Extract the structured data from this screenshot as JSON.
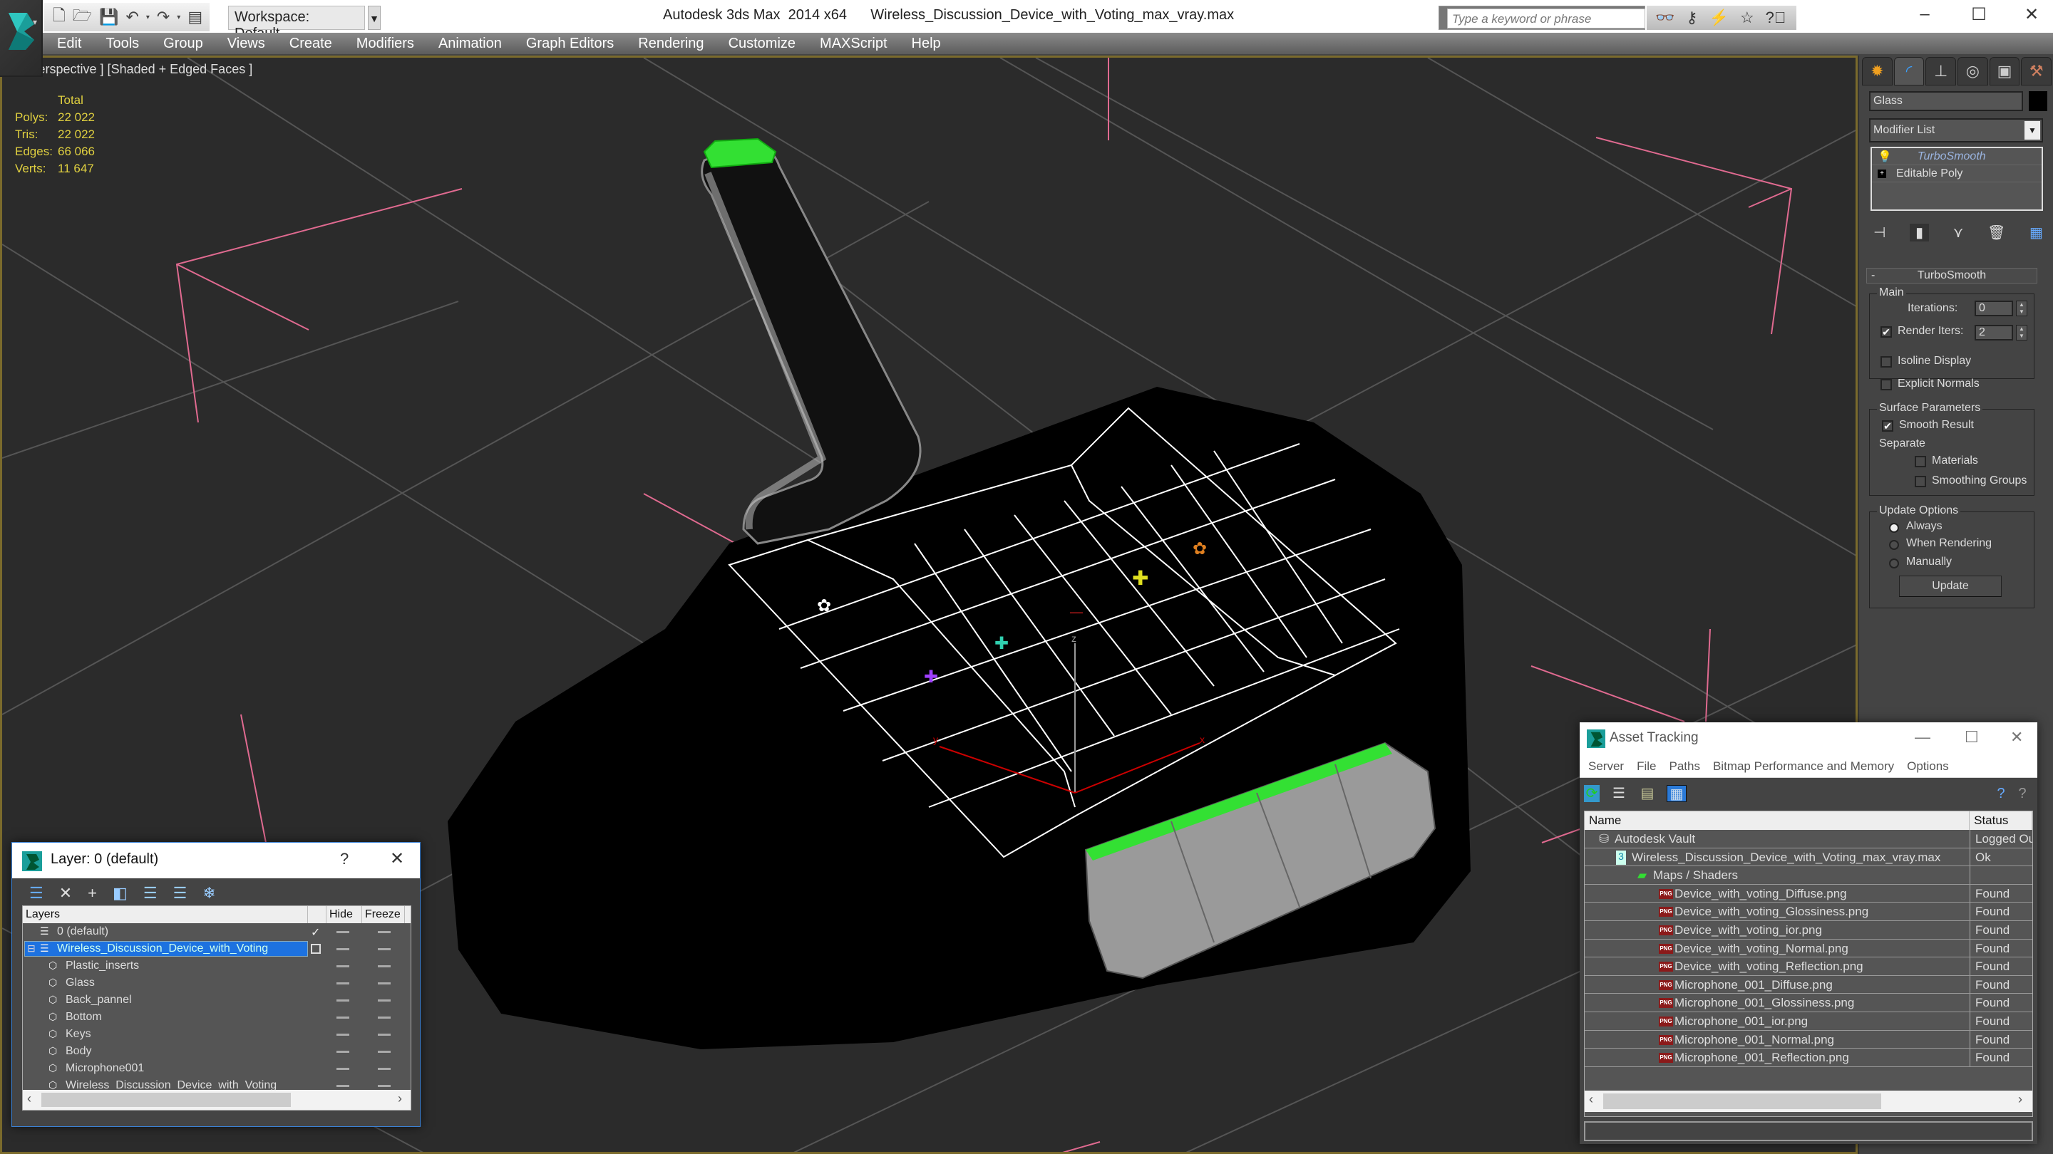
{
  "titlebar": {
    "workspace": "Workspace: Default",
    "app_title": "Autodesk 3ds Max  2014 x64",
    "file_name": "Wireless_Discussion_Device_with_Voting_max_vray.max",
    "search_placeholder": "Type a keyword or phrase",
    "quick_access_icons": [
      "new-file-icon",
      "open-file-icon",
      "save-icon",
      "undo-icon",
      "redo-icon",
      "project-folder-icon"
    ],
    "search_tools": [
      "binoculars-icon",
      "key-icon",
      "subscription-icon",
      "favorites-star-icon",
      "help-icon"
    ],
    "window_controls": [
      "minimize",
      "maximize",
      "close"
    ]
  },
  "menubar": {
    "items": [
      "Edit",
      "Tools",
      "Group",
      "Views",
      "Create",
      "Modifiers",
      "Animation",
      "Graph Editors",
      "Rendering",
      "Customize",
      "MAXScript",
      "Help"
    ]
  },
  "viewport": {
    "label": "[+] [Perspective ] [Shaded + Edged Faces ]",
    "stats": {
      "header": "Total",
      "rows": [
        {
          "key": "Polys:",
          "value": "22 022"
        },
        {
          "key": "Tris:",
          "value": "22 022"
        },
        {
          "key": "Edges:",
          "value": "66 066"
        },
        {
          "key": "Verts:",
          "value": "11 647"
        }
      ]
    },
    "axis_labels": {
      "x": "x",
      "y": "y",
      "z": "z"
    }
  },
  "command_panel": {
    "tabs": [
      "create",
      "modify",
      "hierarchy",
      "motion",
      "display",
      "utilities"
    ],
    "active_tab": "modify",
    "object_name": "Glass",
    "object_color": "#000000",
    "modifier_list_label": "Modifier List",
    "stack": [
      "TurboSmooth",
      "Editable Poly"
    ],
    "rollout_title": "TurboSmooth",
    "main_group": "Main",
    "iterations_label": "Iterations:",
    "iterations_value": "0",
    "render_iters_label": "Render Iters:",
    "render_iters_value": "2",
    "render_iters_checked": true,
    "isoline_label": "Isoline Display",
    "isoline_checked": false,
    "explicit_normals_label": "Explicit Normals",
    "explicit_normals_checked": false,
    "surface_group": "Surface Parameters",
    "smooth_result_label": "Smooth Result",
    "smooth_result_checked": true,
    "separate_label": "Separate",
    "materials_label": "Materials",
    "materials_checked": false,
    "smoothing_groups_label": "Smoothing Groups",
    "smoothing_groups_checked": false,
    "update_group": "Update Options",
    "update_options": [
      "Always",
      "When Rendering",
      "Manually"
    ],
    "update_selected": "Always",
    "update_button": "Update"
  },
  "layer_dialog": {
    "title": "Layer: 0 (default)",
    "help": "?",
    "close": "✕",
    "columns": [
      "Layers",
      "",
      "Hide",
      "Freeze"
    ],
    "rows": [
      {
        "name": "0 (default)",
        "level": 0,
        "type": "layer",
        "current": true
      },
      {
        "name": "Wireless_Discussion_Device_with_Voting",
        "level": 0,
        "type": "layer",
        "selected": true,
        "expanded": true
      },
      {
        "name": "Plastic_inserts",
        "level": 1,
        "type": "object"
      },
      {
        "name": "Glass",
        "level": 1,
        "type": "object"
      },
      {
        "name": "Back_pannel",
        "level": 1,
        "type": "object"
      },
      {
        "name": "Bottom",
        "level": 1,
        "type": "object"
      },
      {
        "name": "Keys",
        "level": 1,
        "type": "object"
      },
      {
        "name": "Body",
        "level": 1,
        "type": "object"
      },
      {
        "name": "Microphone001",
        "level": 1,
        "type": "object"
      },
      {
        "name": "Wireless_Discussion_Device_with_Voting",
        "level": 1,
        "type": "object"
      }
    ]
  },
  "asset_dialog": {
    "title": "Asset Tracking",
    "menu": [
      "Server",
      "File",
      "Paths",
      "Bitmap Performance and Memory",
      "Options"
    ],
    "columns": [
      "Name",
      "Status"
    ],
    "rows": [
      {
        "name": "Autodesk Vault",
        "status": "Logged Ou",
        "level": 0,
        "icon": "vault"
      },
      {
        "name": "Wireless_Discussion_Device_with_Voting_max_vray.max",
        "status": "Ok",
        "level": 1,
        "icon": "max"
      },
      {
        "name": "Maps / Shaders",
        "status": "",
        "level": 2,
        "icon": "maps"
      },
      {
        "name": "Device_with_voting_Diffuse.png",
        "status": "Found",
        "level": 3,
        "icon": "png"
      },
      {
        "name": "Device_with_voting_Glossiness.png",
        "status": "Found",
        "level": 3,
        "icon": "png"
      },
      {
        "name": "Device_with_voting_ior.png",
        "status": "Found",
        "level": 3,
        "icon": "png"
      },
      {
        "name": "Device_with_voting_Normal.png",
        "status": "Found",
        "level": 3,
        "icon": "png"
      },
      {
        "name": "Device_with_voting_Reflection.png",
        "status": "Found",
        "level": 3,
        "icon": "png"
      },
      {
        "name": "Microphone_001_Diffuse.png",
        "status": "Found",
        "level": 3,
        "icon": "png"
      },
      {
        "name": "Microphone_001_Glossiness.png",
        "status": "Found",
        "level": 3,
        "icon": "png"
      },
      {
        "name": "Microphone_001_ior.png",
        "status": "Found",
        "level": 3,
        "icon": "png"
      },
      {
        "name": "Microphone_001_Normal.png",
        "status": "Found",
        "level": 3,
        "icon": "png"
      },
      {
        "name": "Microphone_001_Reflection.png",
        "status": "Found",
        "level": 3,
        "icon": "png"
      }
    ]
  }
}
